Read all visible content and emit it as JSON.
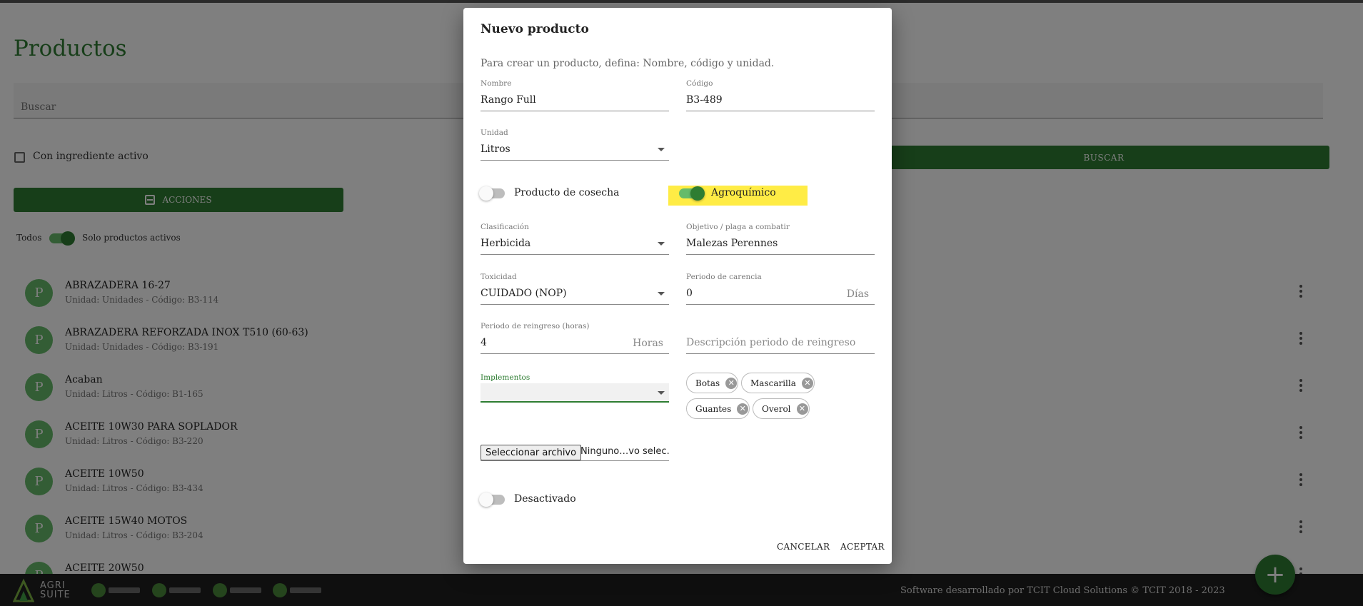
{
  "page": {
    "title": "Productos",
    "search_placeholder": "Buscar",
    "checkbox_label": "Con ingrediente activo",
    "search_button": "BUSCAR",
    "actions_button": "ACCIONES",
    "filter_all": "Todos",
    "filter_active": "Solo productos activos",
    "avatar_letter": "P",
    "products": [
      {
        "name": "ABRAZADERA 16-27",
        "sub": "Unidad: Unidades - Código: B3-114"
      },
      {
        "name": "ABRAZADERA REFORZADA INOX T510 (60-63)",
        "sub": "Unidad: Unidades - Código: B3-191"
      },
      {
        "name": "Acaban",
        "sub": "Unidad: Litros - Código: B1-165"
      },
      {
        "name": "ACEITE 10W30 PARA SOPLADOR",
        "sub": "Unidad: Litros - Código: B3-220"
      },
      {
        "name": "ACEITE 10W50",
        "sub": "Unidad: Litros - Código: B3-434"
      },
      {
        "name": "ACEITE 15W40 MOTOS",
        "sub": "Unidad: Litros - Código: B3-204"
      },
      {
        "name": "ACEITE 20W50",
        "sub": ""
      }
    ],
    "fab_icon": "+"
  },
  "footer": {
    "brand_line1": "AGRI",
    "brand_line2": "SUITE",
    "credit": "Software desarrollado por TCIT Cloud Solutions © TCIT 2018 - 2023"
  },
  "dialog": {
    "title": "Nuevo producto",
    "description": "Para crear un producto, defina: Nombre, código y unidad.",
    "nombre_label": "Nombre",
    "nombre_value": "Rango Full",
    "codigo_label": "Código",
    "codigo_value": "B3-489",
    "unidad_label": "Unidad",
    "unidad_value": "Litros",
    "cosecha_label": "Producto de cosecha",
    "cosecha_on": false,
    "agroquimico_label": "Agroquímico",
    "agroquimico_on": true,
    "clasificacion_label": "Clasificación",
    "clasificacion_value": "Herbicida",
    "objetivo_label": "Objetivo / plaga a combatir",
    "objetivo_value": "Malezas Perennes",
    "toxicidad_label": "Toxicidad",
    "toxicidad_value": "CUIDADO (NOP)",
    "carencia_label": "Periodo de carencia",
    "carencia_value": "0",
    "carencia_suffix": "Días",
    "reingreso_label": "Periodo de reingreso (horas)",
    "reingreso_value": "4",
    "reingreso_suffix": "Horas",
    "reingreso_desc_placeholder": "Descripción periodo de reingreso",
    "implementos_label": "Implementos",
    "chips": [
      "Botas",
      "Mascarilla",
      "Guantes",
      "Overol"
    ],
    "file_button": "Seleccionar archivo",
    "file_name": "Ninguno…vo selec.",
    "desactivado_label": "Desactivado",
    "desactivado_on": false,
    "cancel": "CANCELAR",
    "accept": "ACEPTAR"
  },
  "colors": {
    "primary": "#2e7d32",
    "primary_light": "#66bb6a",
    "highlight": "#ffeb3b",
    "footer_bg": "#1e1e1e"
  }
}
